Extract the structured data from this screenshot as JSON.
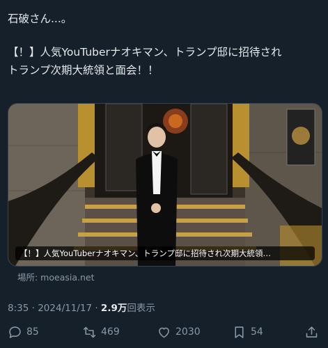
{
  "post": {
    "line1": "石破さん...。",
    "line2": "【！】人気YouTuberナオキマン、トランプ邸に招待され",
    "line3": "トランプ次期大統領と面会！！"
  },
  "media": {
    "caption": "【！】人気YouTuberナオキマン、トランプ邸に招待され次期大統領…"
  },
  "source": {
    "text": "場所: moeasia.net"
  },
  "meta": {
    "time": "8:35",
    "date": "2024/11/17",
    "views": "2.9万",
    "views_label": "回表示"
  },
  "actions": {
    "replies": "85",
    "reposts": "469",
    "likes": "2030",
    "bookmarks": "54"
  },
  "icons": [
    "reply-icon",
    "repost-icon",
    "like-icon",
    "bookmark-icon",
    "share-icon"
  ],
  "colors": {
    "background": "#15202b",
    "text": "#e7e9ea",
    "secondary": "#8b98a5"
  }
}
